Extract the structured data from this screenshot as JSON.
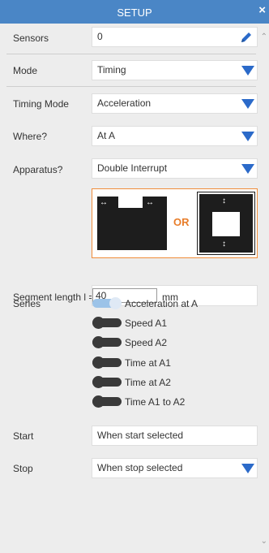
{
  "header": {
    "title": "SETUP",
    "close": "×"
  },
  "sensors": {
    "label": "Sensors",
    "value": "0"
  },
  "mode": {
    "label": "Mode",
    "value": "Timing"
  },
  "timing_mode": {
    "label": "Timing Mode",
    "value": "Acceleration"
  },
  "where": {
    "label": "Where?",
    "value": "At A"
  },
  "apparatus": {
    "label": "Apparatus?",
    "value": "Double Interrupt",
    "or_text": "OR"
  },
  "segment": {
    "label": "Segment length l =",
    "value": "40",
    "unit": "mm"
  },
  "series": {
    "label": "Series",
    "items": [
      {
        "label": "Acceleration at A",
        "on": true
      },
      {
        "label": "Speed A1",
        "on": false
      },
      {
        "label": "Speed A2",
        "on": false
      },
      {
        "label": "Time at A1",
        "on": false
      },
      {
        "label": "Time at A2",
        "on": false
      },
      {
        "label": "Time A1 to A2",
        "on": false
      }
    ]
  },
  "start": {
    "label": "Start",
    "value": "When start selected"
  },
  "stop": {
    "label": "Stop",
    "value": "When stop selected"
  },
  "colors": {
    "header": "#4a86c6",
    "accent": "#2b6ac9",
    "orange": "#ef8c3a"
  }
}
